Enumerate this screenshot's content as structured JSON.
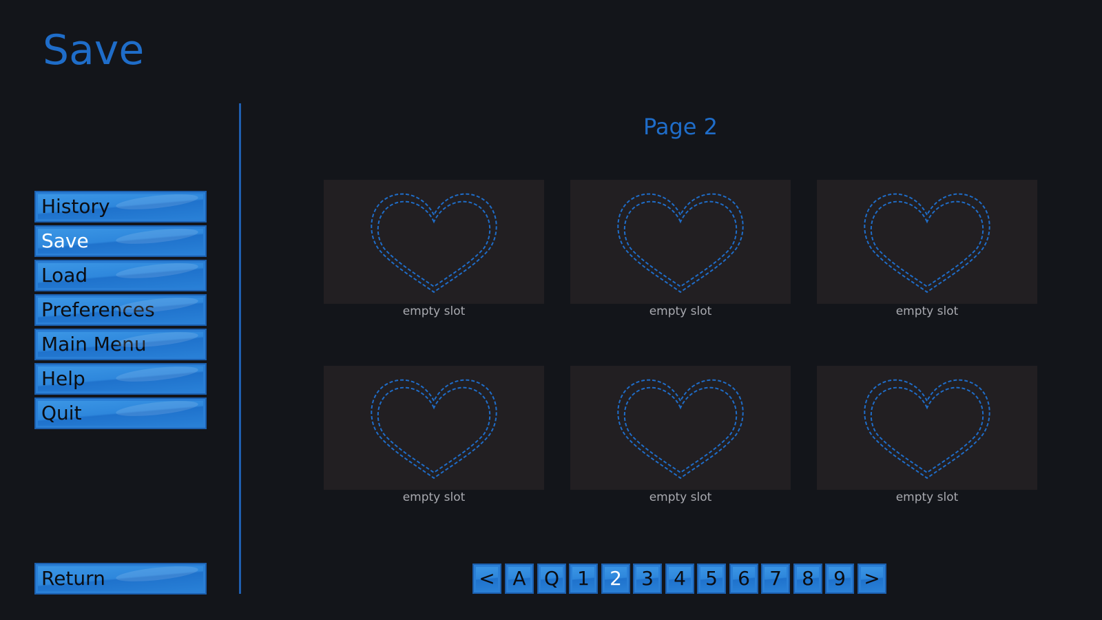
{
  "screen": {
    "title": "Save"
  },
  "nav": {
    "items": [
      {
        "label": "History",
        "selected": false
      },
      {
        "label": "Save",
        "selected": true
      },
      {
        "label": "Load",
        "selected": false
      },
      {
        "label": "Preferences",
        "selected": false
      },
      {
        "label": "Main Menu",
        "selected": false
      },
      {
        "label": "Help",
        "selected": false
      },
      {
        "label": "Quit",
        "selected": false
      }
    ],
    "return_label": "Return"
  },
  "page": {
    "heading": "Page 2"
  },
  "slots": [
    {
      "label": "empty slot",
      "icon": "heart-outline-icon"
    },
    {
      "label": "empty slot",
      "icon": "heart-outline-icon"
    },
    {
      "label": "empty slot",
      "icon": "heart-outline-icon"
    },
    {
      "label": "empty slot",
      "icon": "heart-outline-icon"
    },
    {
      "label": "empty slot",
      "icon": "heart-outline-icon"
    },
    {
      "label": "empty slot",
      "icon": "heart-outline-icon"
    }
  ],
  "pager": {
    "buttons": [
      "<",
      "A",
      "Q",
      "1",
      "2",
      "3",
      "4",
      "5",
      "6",
      "7",
      "8",
      "9",
      ">"
    ],
    "selected": "2"
  },
  "colors": {
    "accent": "#1f6dc9",
    "button": "#2e87dc",
    "background": "#13151a",
    "slot_background": "#221f22"
  }
}
